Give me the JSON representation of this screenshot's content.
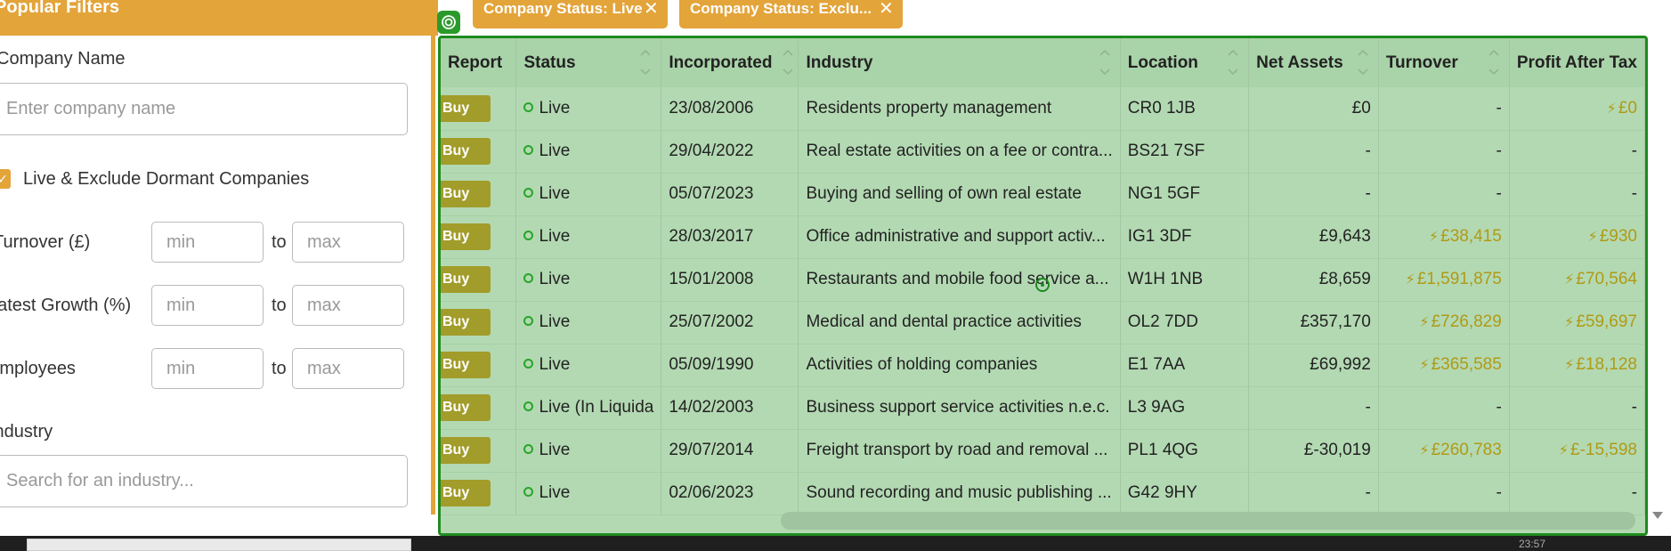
{
  "filters": {
    "header": "Popular Filters",
    "company_name_label": "Company Name",
    "company_name_placeholder": "Enter company name",
    "live_checkbox_label": "Live & Exclude Dormant Companies",
    "turnover_label": "Turnover (£)",
    "growth_label": "Latest Growth (%)",
    "employees_label": "Employees",
    "min_placeholder": "min",
    "max_placeholder": "max",
    "to": "to",
    "industry_label": "Industry",
    "industry_placeholder": "Search for an industry..."
  },
  "chips": [
    {
      "label": "Company Status: Live"
    },
    {
      "label": "Company Status: Exclu..."
    }
  ],
  "table": {
    "columns": [
      "Report",
      "Status",
      "Incorporated",
      "Industry",
      "Location",
      "Net Assets",
      "Turnover",
      "Profit After Tax"
    ],
    "buy_label": "Buy",
    "rows": [
      {
        "status": "Live",
        "incorporated": "23/08/2006",
        "industry": "Residents property management",
        "location": "CR0 1JB",
        "net_assets": "£0",
        "turnover": "-",
        "profit": "£0",
        "turnover_est": false,
        "profit_est": true
      },
      {
        "status": "Live",
        "incorporated": "29/04/2022",
        "industry": "Real estate activities on a fee or contra...",
        "location": "BS21 7SF",
        "net_assets": "-",
        "turnover": "-",
        "profit": "-",
        "turnover_est": false,
        "profit_est": false
      },
      {
        "status": "Live",
        "incorporated": "05/07/2023",
        "industry": "Buying and selling of own real estate",
        "location": "NG1 5GF",
        "net_assets": "-",
        "turnover": "-",
        "profit": "-",
        "turnover_est": false,
        "profit_est": false
      },
      {
        "status": "Live",
        "incorporated": "28/03/2017",
        "industry": "Office administrative and support activ...",
        "location": "IG1 3DF",
        "net_assets": "£9,643",
        "turnover": "£38,415",
        "profit": "£930",
        "turnover_est": true,
        "profit_est": true
      },
      {
        "status": "Live",
        "incorporated": "15/01/2008",
        "industry": "Restaurants and mobile food service a...",
        "location": "W1H 1NB",
        "net_assets": "£8,659",
        "turnover": "£1,591,875",
        "profit": "£70,564",
        "turnover_est": true,
        "profit_est": true
      },
      {
        "status": "Live",
        "incorporated": "25/07/2002",
        "industry": "Medical and dental practice activities",
        "location": "OL2 7DD",
        "net_assets": "£357,170",
        "turnover": "£726,829",
        "profit": "£59,697",
        "turnover_est": true,
        "profit_est": true
      },
      {
        "status": "Live",
        "incorporated": "05/09/1990",
        "industry": "Activities of holding companies",
        "location": "E1 7AA",
        "net_assets": "£69,992",
        "turnover": "£365,585",
        "profit": "£18,128",
        "turnover_est": true,
        "profit_est": true
      },
      {
        "status": "Live (In Liquida",
        "incorporated": "14/02/2003",
        "industry": "Business support service activities n.e.c.",
        "location": "L3 9AG",
        "net_assets": "-",
        "turnover": "-",
        "profit": "-",
        "turnover_est": false,
        "profit_est": false
      },
      {
        "status": "Live",
        "incorporated": "29/07/2014",
        "industry": "Freight transport by road and removal ...",
        "location": "PL1 4QG",
        "net_assets": "£-30,019",
        "turnover": "£260,783",
        "profit": "£-15,598",
        "turnover_est": true,
        "profit_est": true
      },
      {
        "status": "Live",
        "incorporated": "02/06/2023",
        "industry": "Sound recording and music publishing ...",
        "location": "G42 9HY",
        "net_assets": "-",
        "turnover": "-",
        "profit": "-",
        "turnover_est": false,
        "profit_est": false
      }
    ]
  },
  "taskbar": {
    "clock": "23:57"
  },
  "colors": {
    "accent": "#e3a43a",
    "table_bg": "#b3d9b3",
    "border_green": "#1f8a1f",
    "estimate_gold": "#b09a15",
    "buy_button": "#a29c2a"
  },
  "icons": {
    "chip_close": "close-icon",
    "estimate": "lightning-icon",
    "status": "status-dot-icon",
    "sort": "sort-arrows-icon"
  }
}
